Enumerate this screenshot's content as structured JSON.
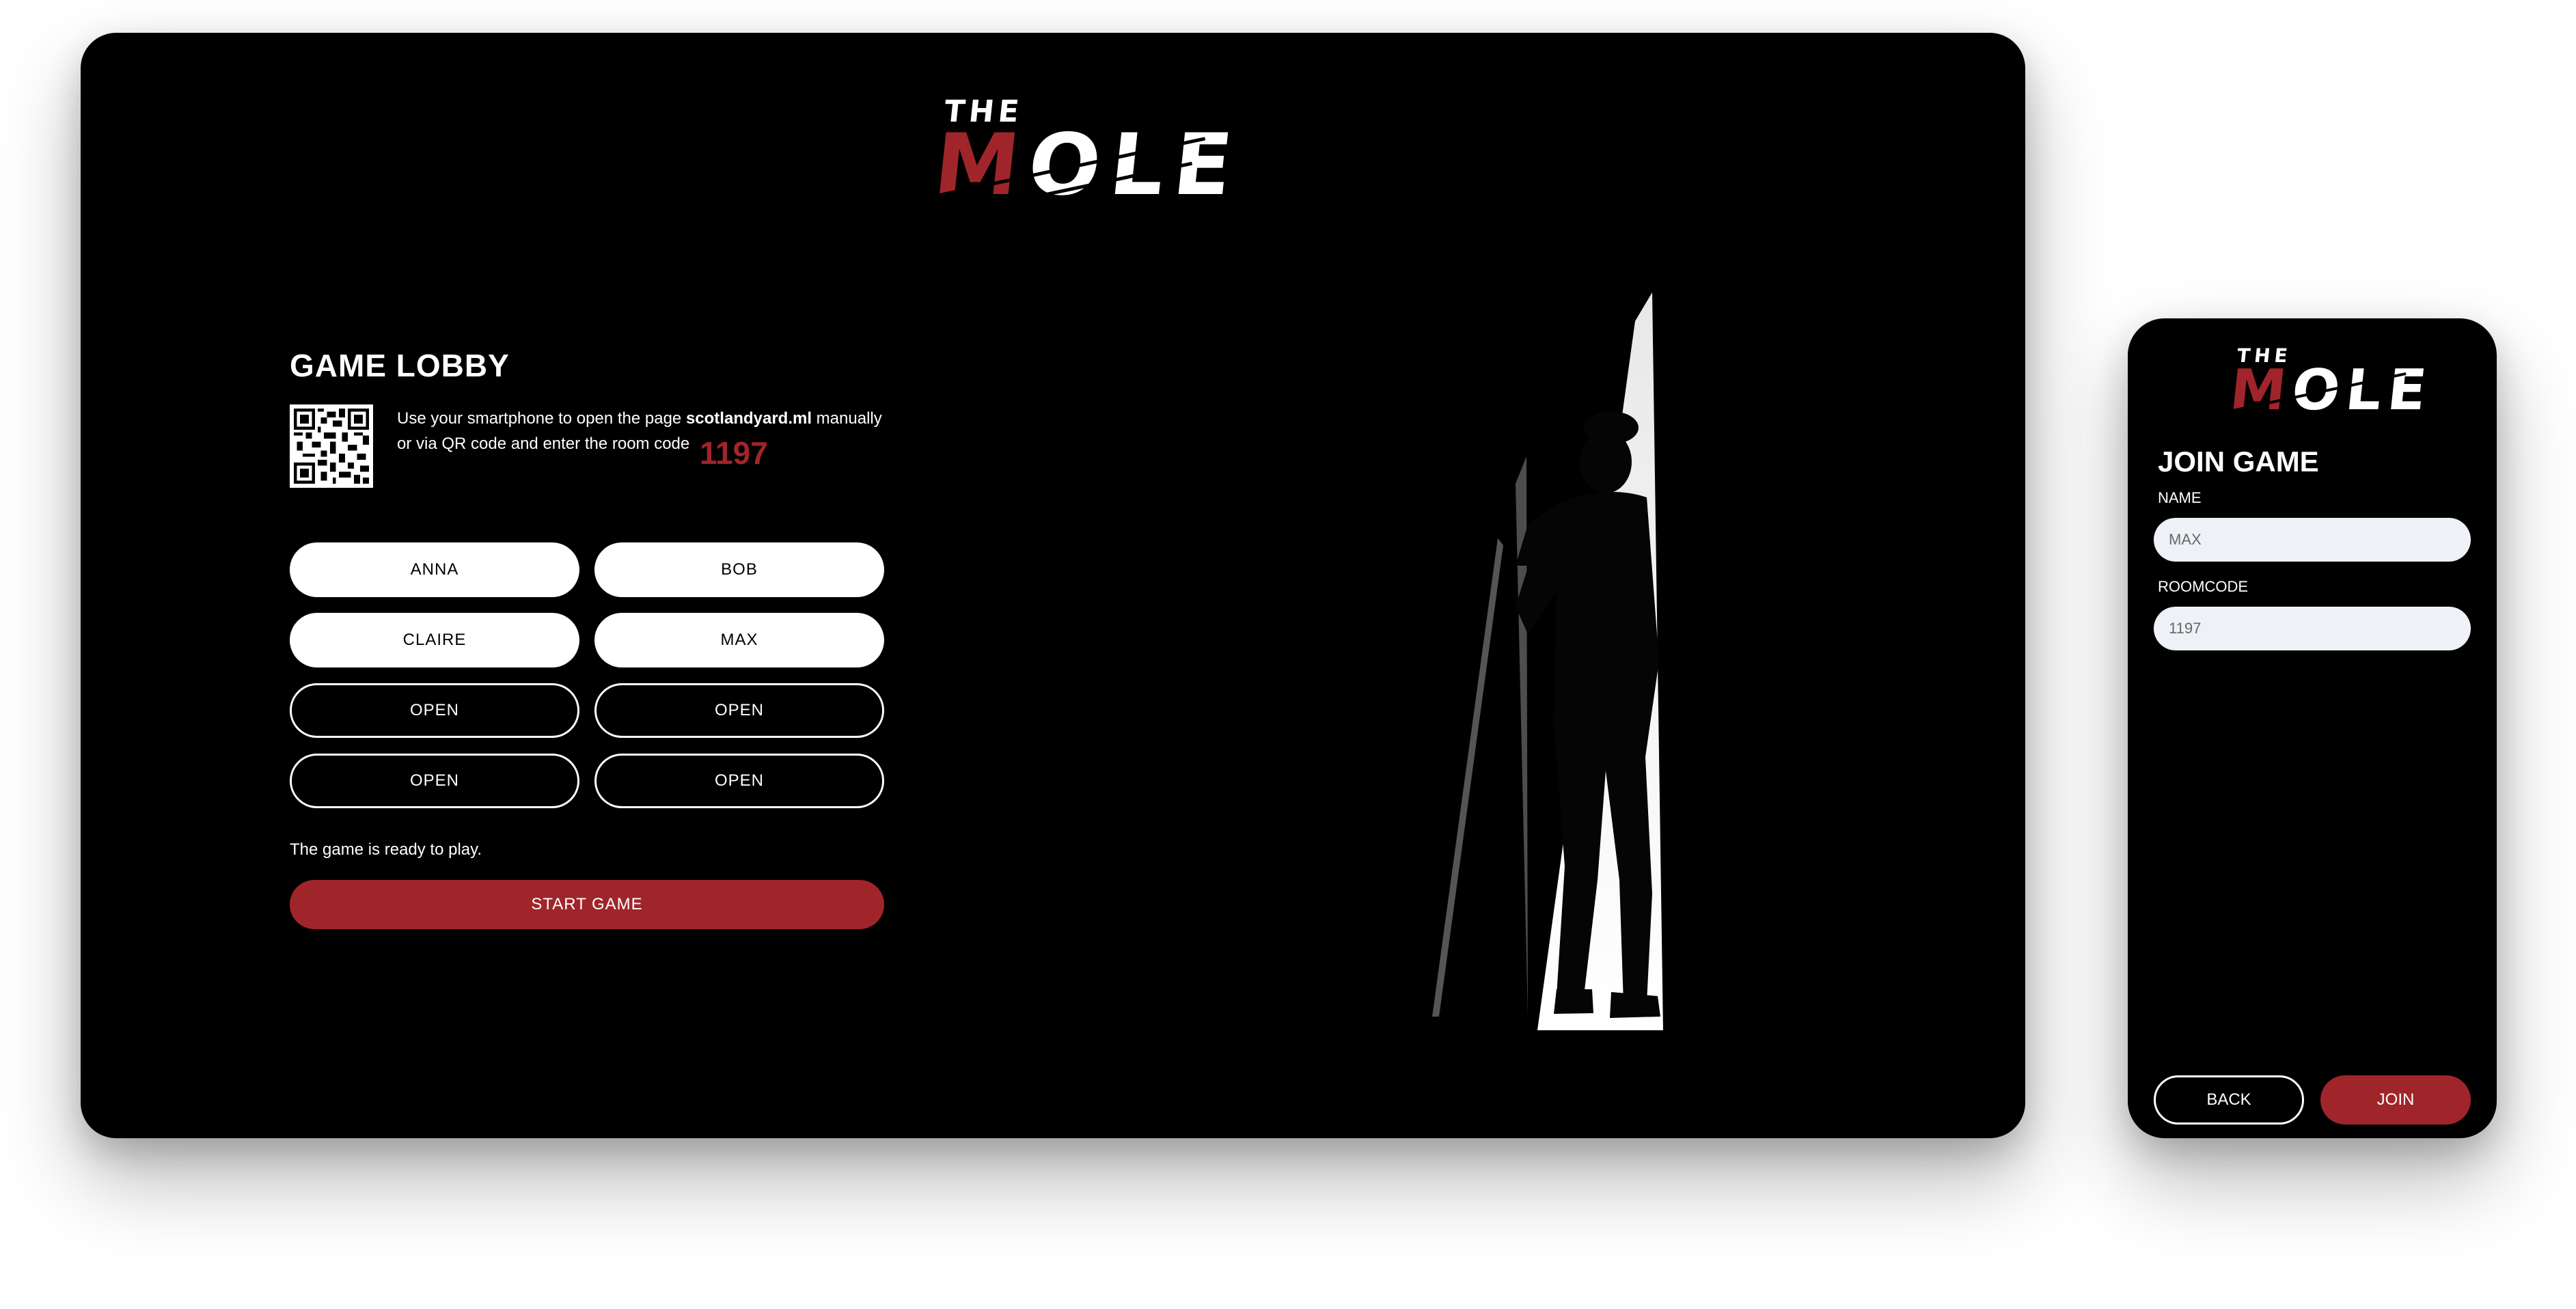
{
  "brand": {
    "the": "THE",
    "mole_first": "M",
    "mole_rest": "OLE",
    "accent": "#a0252a"
  },
  "desktop": {
    "title": "GAME LOBBY",
    "instructions_before": "Use your smartphone to open the page ",
    "instructions_site": "scotlandyard.ml",
    "instructions_after": " manually or via QR code and enter the room code",
    "room_code": "1197",
    "slots": [
      "ANNA",
      "BOB",
      "CLAIRE",
      "MAX",
      "OPEN",
      "OPEN",
      "OPEN",
      "OPEN"
    ],
    "status": "The game is ready to play.",
    "start_label": "START GAME"
  },
  "mobile": {
    "title": "JOIN GAME",
    "name_label": "NAME",
    "name_value": "MAX",
    "roomcode_label": "ROOMCODE",
    "roomcode_value": "1197",
    "back_label": "BACK",
    "join_label": "JOIN"
  }
}
